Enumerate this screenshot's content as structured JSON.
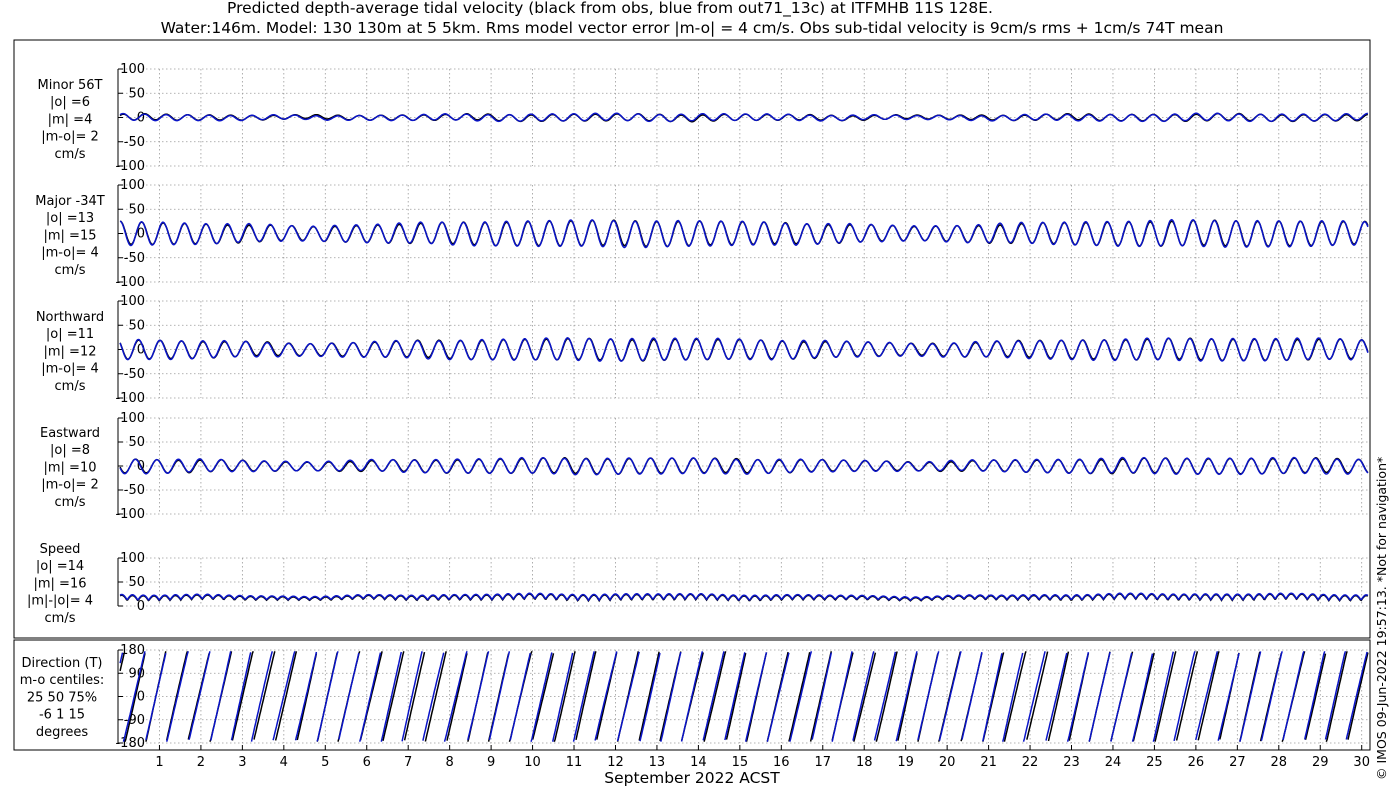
{
  "title_line1": "Predicted depth-average tidal velocity (black from obs, blue from out71_13c) at ITFMHB 11S 128E.",
  "title_line2": "Water:146m. Model: 130 130m at 5 5km. Rms model vector error |m-o| = 4 cm/s. Obs sub-tidal velocity is 9cm/s rms + 1cm/s 74T mean",
  "credit": "© IMOS 09-Jun-2022 19:57:13. *Not for navigation*",
  "colors": {
    "obs": "#000000",
    "model": "#0a14c8"
  },
  "chart_data": {
    "type": "line",
    "xlabel": "September 2022 ACST",
    "x_ticks": [
      1,
      2,
      3,
      4,
      5,
      6,
      7,
      8,
      9,
      10,
      11,
      12,
      13,
      14,
      15,
      16,
      17,
      18,
      19,
      20,
      21,
      22,
      23,
      24,
      25,
      26,
      27,
      28,
      29,
      30
    ],
    "xlim": [
      0,
      30.2
    ],
    "series_legend": [
      "black from obs",
      "blue from out71_13c"
    ],
    "panels": [
      {
        "id": "minor",
        "label": [
          "Minor 56T",
          "|o| =6",
          "|m| =4",
          "|m-o|= 2",
          "cm/s"
        ],
        "ylim": [
          -100,
          100
        ],
        "yticks": [
          "100",
          "50",
          "0",
          "-50",
          "-100"
        ],
        "ytick_values": [
          100,
          50,
          0,
          -50,
          -100
        ],
        "amplitude": 7,
        "offset": 0
      },
      {
        "id": "major",
        "label": [
          "Major -34T",
          "|o| =13",
          "|m| =15",
          "|m-o|= 4",
          "cm/s"
        ],
        "ylim": [
          -100,
          100
        ],
        "yticks": [
          "100",
          "50",
          "0",
          "-50",
          "-100"
        ],
        "ytick_values": [
          100,
          50,
          0,
          -50,
          -100
        ],
        "amplitude": 26,
        "offset": 0
      },
      {
        "id": "northward",
        "label": [
          "Northward",
          "|o| =11",
          "|m| =12",
          "|m-o|= 4",
          "cm/s"
        ],
        "ylim": [
          -100,
          100
        ],
        "yticks": [
          "100",
          "50",
          "0",
          "-50",
          "-100"
        ],
        "ytick_values": [
          100,
          50,
          0,
          -50,
          -100
        ],
        "amplitude": 22,
        "offset": 0
      },
      {
        "id": "eastward",
        "label": [
          "Eastward",
          "|o| =8",
          "|m| =10",
          "|m-o|= 2",
          "cm/s"
        ],
        "ylim": [
          -100,
          100
        ],
        "yticks": [
          "100",
          "50",
          "0",
          "-50",
          "-100"
        ],
        "ytick_values": [
          100,
          50,
          0,
          -50,
          -100
        ],
        "amplitude": 16,
        "offset": 0
      },
      {
        "id": "speed",
        "label": [
          "Speed",
          "|o| =14",
          "|m| =16",
          "|m|-|o|= 4",
          "cm/s"
        ],
        "ylim": [
          0,
          100
        ],
        "yticks": [
          "100",
          "50",
          "0"
        ],
        "ytick_values": [
          100,
          50,
          0
        ],
        "amplitude": 12,
        "offset": 12
      },
      {
        "id": "direction",
        "label": [
          "Direction (T)",
          "m-o centiles:",
          "25  50  75%",
          "-6   1  15",
          "degrees"
        ],
        "ylim": [
          -180,
          180
        ],
        "yticks": [
          "180",
          "90",
          "0",
          "-90",
          "-180"
        ],
        "ytick_values": [
          180,
          90,
          0,
          -90,
          -180
        ],
        "amplitude": 180,
        "offset": 0
      }
    ]
  }
}
